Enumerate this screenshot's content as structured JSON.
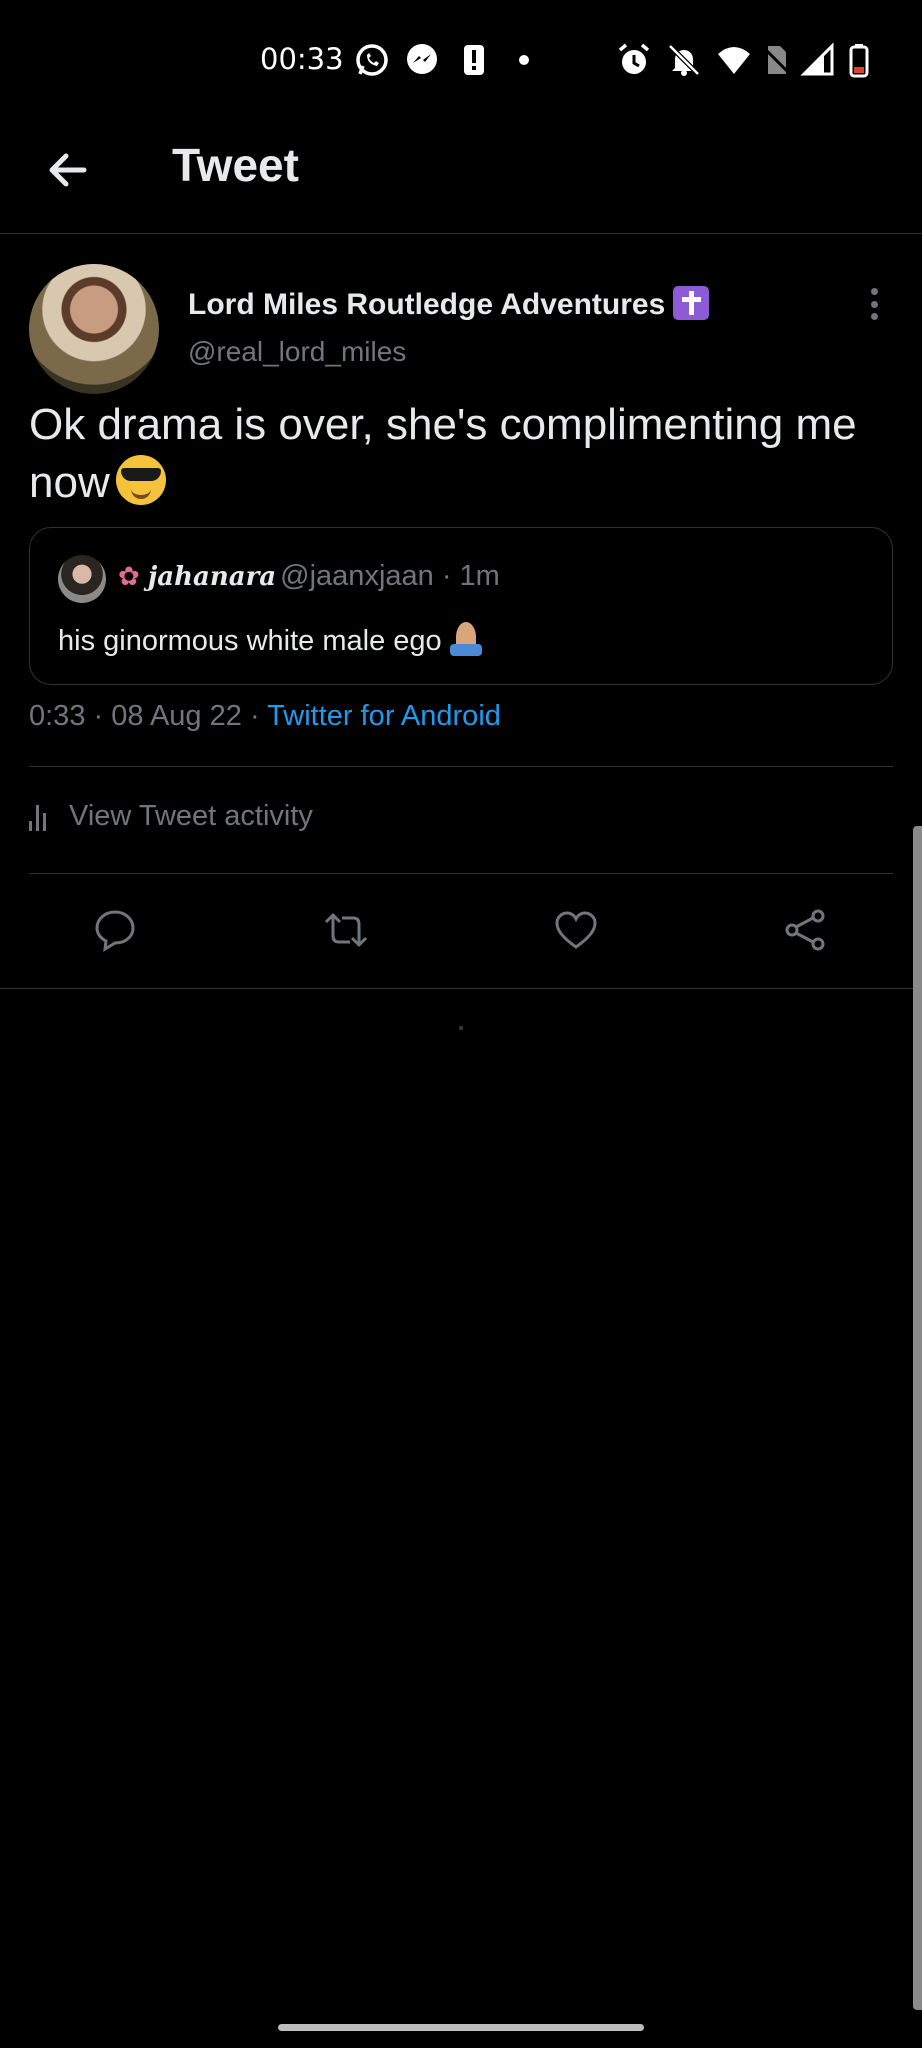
{
  "status_bar": {
    "time": "00:33",
    "left_icons": [
      "whatsapp-icon",
      "messenger-icon",
      "alert-icon",
      "dot-icon"
    ],
    "right_icons": [
      "alarm-icon",
      "notifications-off-icon",
      "wifi-icon",
      "no-sim-icon",
      "signal-icon",
      "battery-icon"
    ]
  },
  "header": {
    "title": "Tweet"
  },
  "tweet": {
    "author_name": "Lord Miles Routledge Adventures",
    "author_handle": "@real_lord_miles",
    "text": "Ok drama is over, she's complimenting me now",
    "quote": {
      "name": "jahanara",
      "handle": "@jaanxjaan",
      "age": "· 1m",
      "text": "his ginormous white male ego"
    },
    "meta": {
      "time": "0:33",
      "separator": "·",
      "date": "08 Aug 22",
      "source": "Twitter for Android"
    },
    "activity_label": "View Tweet activity"
  },
  "actions": [
    "reply-icon",
    "retweet-icon",
    "like-icon",
    "share-icon"
  ],
  "colors": {
    "background": "#000000",
    "accent": "#1d9bf0",
    "muted": "#71767b",
    "text": "#e7e9ea",
    "border": "#2f3336"
  }
}
